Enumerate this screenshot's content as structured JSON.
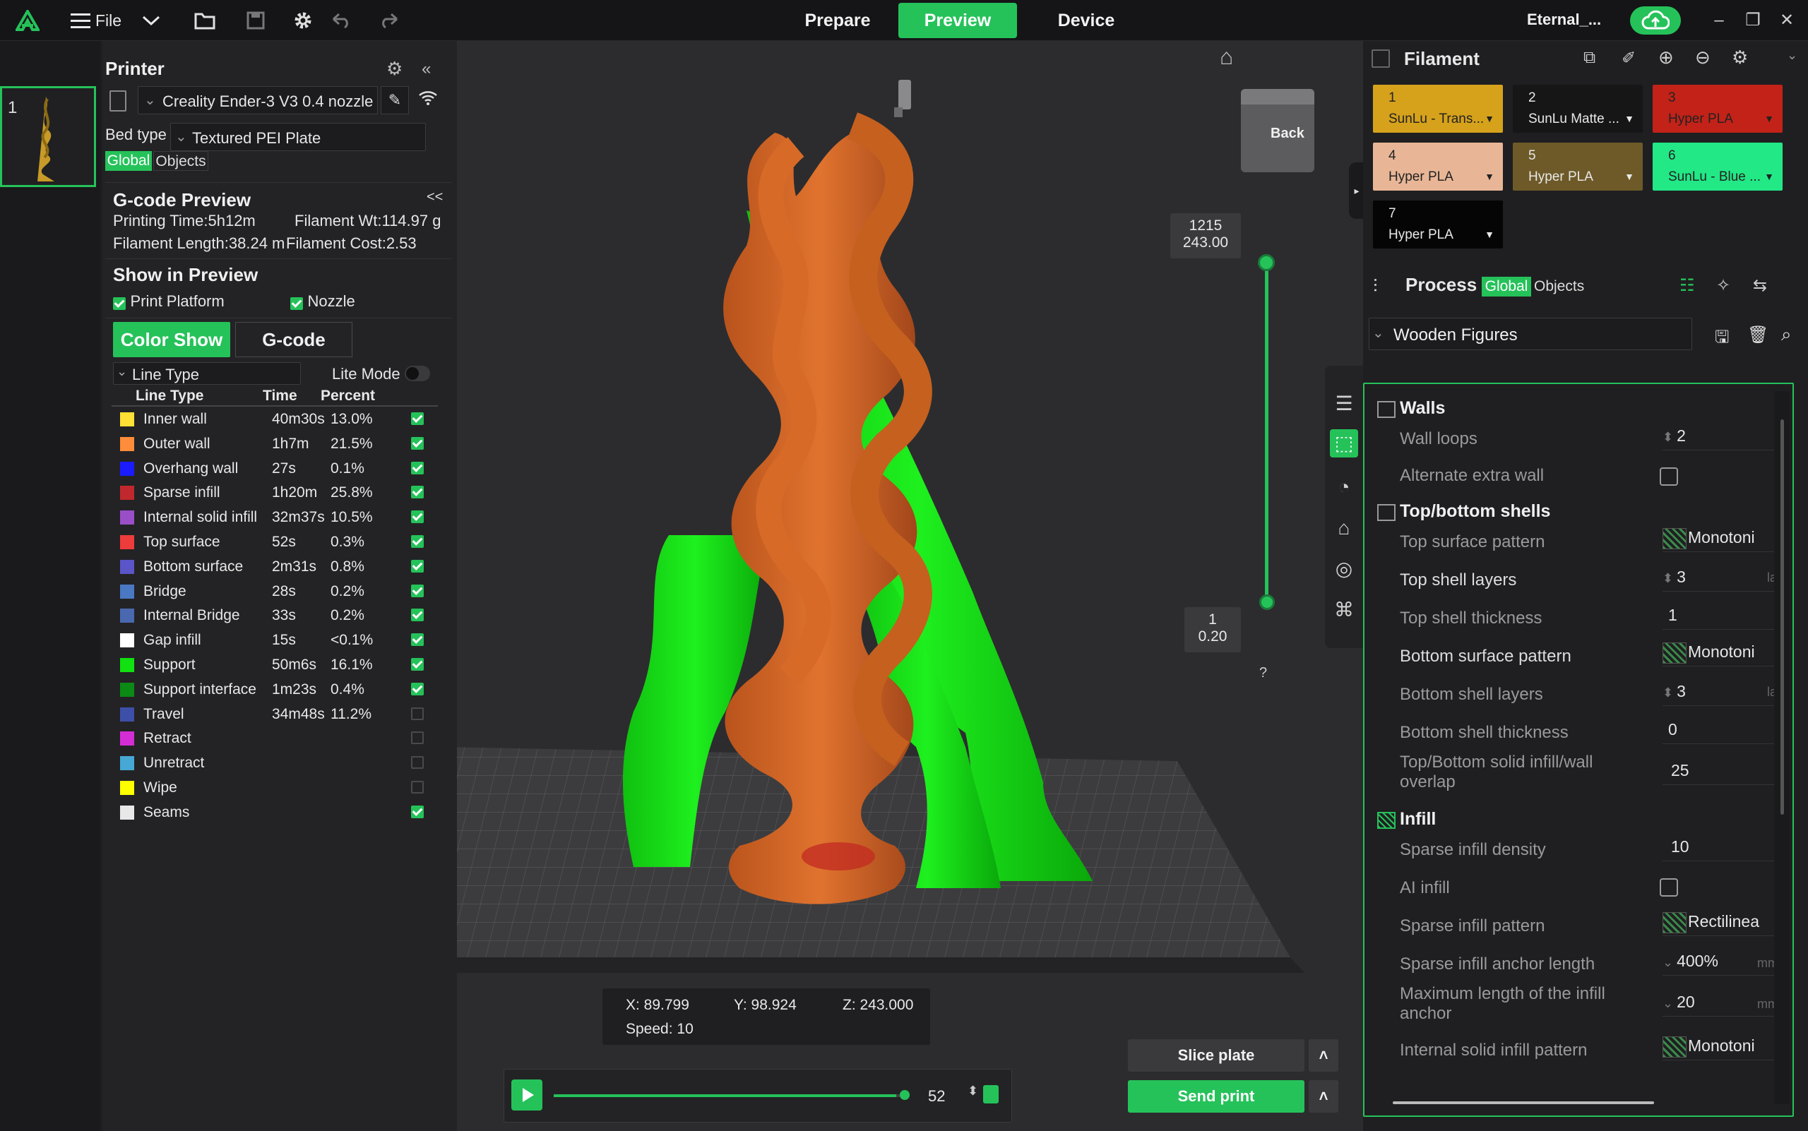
{
  "topbar": {
    "file_label": "File",
    "tabs": [
      "Prepare",
      "Preview",
      "Device"
    ],
    "user": "Eternal_..."
  },
  "thumb": {
    "number": "1"
  },
  "printer": {
    "title": "Printer",
    "name": "Creality Ender-3 V3 0.4 nozzle",
    "bed_type_label": "Bed type",
    "bed_type": "Textured PEI Plate",
    "scope_global": "Global",
    "scope_objects": "Objects"
  },
  "gcode_preview": {
    "title": "G-code Preview",
    "collapse": "<<",
    "printing_time": "Printing Time:5h12m",
    "filament_wt": "Filament Wt:114.97 g",
    "filament_length": "Filament Length:38.24 m",
    "filament_cost": "Filament Cost:2.53"
  },
  "show_in_preview": {
    "title": "Show in Preview",
    "print_platform": "Print Platform",
    "nozzle": "Nozzle"
  },
  "view_mode": {
    "color_show": "Color Show",
    "gcode": "G-code"
  },
  "line_type_selector": {
    "value": "Line Type",
    "lite_mode": "Lite Mode"
  },
  "line_table": {
    "headers": [
      "Line Type",
      "Time",
      "Percent"
    ],
    "rows": [
      {
        "name": "Inner wall",
        "time": "40m30s",
        "percent": "13.0%",
        "color": "#ffe135",
        "checked": true
      },
      {
        "name": "Outer wall",
        "time": "1h7m",
        "percent": "21.5%",
        "color": "#ff8c3a",
        "checked": true
      },
      {
        "name": "Overhang wall",
        "time": "27s",
        "percent": "0.1%",
        "color": "#1b1bff",
        "checked": true
      },
      {
        "name": "Sparse infill",
        "time": "1h20m",
        "percent": "25.8%",
        "color": "#c0282d",
        "checked": true
      },
      {
        "name": "Internal solid infill",
        "time": "32m37s",
        "percent": "10.5%",
        "color": "#9a4fc8",
        "checked": true
      },
      {
        "name": "Top surface",
        "time": "52s",
        "percent": "0.3%",
        "color": "#ee3b3b",
        "checked": true
      },
      {
        "name": "Bottom surface",
        "time": "2m31s",
        "percent": "0.8%",
        "color": "#5a55c8",
        "checked": true
      },
      {
        "name": "Bridge",
        "time": "28s",
        "percent": "0.2%",
        "color": "#4a78c2",
        "checked": true
      },
      {
        "name": "Internal Bridge",
        "time": "33s",
        "percent": "0.2%",
        "color": "#4a68b0",
        "checked": true
      },
      {
        "name": "Gap infill",
        "time": "15s",
        "percent": "<0.1%",
        "color": "#ffffff",
        "checked": true
      },
      {
        "name": "Support",
        "time": "50m6s",
        "percent": "16.1%",
        "color": "#11e011",
        "checked": true
      },
      {
        "name": "Support interface",
        "time": "1m23s",
        "percent": "0.4%",
        "color": "#0b8a16",
        "checked": true
      },
      {
        "name": "Travel",
        "time": "34m48s",
        "percent": "11.2%",
        "color": "#3d4fa8",
        "checked": false
      },
      {
        "name": "Retract",
        "time": "",
        "percent": "",
        "color": "#d52dd5",
        "checked": false
      },
      {
        "name": "Unretract",
        "time": "",
        "percent": "",
        "color": "#46a8d4",
        "checked": false
      },
      {
        "name": "Wipe",
        "time": "",
        "percent": "",
        "color": "#ffff00",
        "checked": false
      },
      {
        "name": "Seams",
        "time": "",
        "percent": "",
        "color": "#e8e8e8",
        "checked": true
      }
    ]
  },
  "viewport": {
    "view_cube": "Back",
    "layer_top": "1215",
    "height_top": "243.00",
    "layer_bottom": "1",
    "height_bottom": "0.20",
    "help": "?",
    "coords": {
      "x": "X: 89.799",
      "y": "Y: 98.924",
      "z": "Z: 243.000",
      "speed": "Speed: 10"
    },
    "progress_value": "52",
    "progress_fraction": 0.99
  },
  "actions": {
    "slice": "Slice plate",
    "send": "Send print"
  },
  "filament": {
    "title": "Filament",
    "slots": [
      {
        "num": "1",
        "name": "SunLu - Trans...",
        "color": "#d6a21c",
        "text": "#222"
      },
      {
        "num": "2",
        "name": "SunLu Matte ...",
        "color": "#161616",
        "text": "#e8e8e8"
      },
      {
        "num": "3",
        "name": "Hyper PLA",
        "color": "#c22218",
        "text": "#222"
      },
      {
        "num": "4",
        "name": "Hyper PLA",
        "color": "#e8b696",
        "text": "#222"
      },
      {
        "num": "5",
        "name": "Hyper PLA",
        "color": "#6e5a28",
        "text": "#e8e8e8"
      },
      {
        "num": "6",
        "name": "SunLu - Blue ...",
        "color": "#22e886",
        "text": "#222"
      },
      {
        "num": "7",
        "name": "Hyper PLA",
        "color": "#050505",
        "text": "#e8e8e8"
      }
    ]
  },
  "process": {
    "title": "Process",
    "scope_global": "Global",
    "scope_objects": "Objects",
    "preset": "Wooden Figures",
    "sections": {
      "walls": "Walls",
      "top_bottom": "Top/bottom shells",
      "infill": "Infill"
    },
    "settings": {
      "wall_loops": {
        "label": "Wall loops",
        "value": "2"
      },
      "alternate_extra_wall": {
        "label": "Alternate extra wall"
      },
      "top_surface_pattern": {
        "label": "Top surface pattern",
        "value": "Monotoni"
      },
      "top_shell_layers": {
        "label": "Top shell layers",
        "value": "3",
        "unit": "la"
      },
      "top_shell_thickness": {
        "label": "Top shell thickness",
        "value": "1"
      },
      "bottom_surface_pattern": {
        "label": "Bottom surface pattern",
        "value": "Monotoni"
      },
      "bottom_shell_layers": {
        "label": "Bottom shell layers",
        "value": "3",
        "unit": "la"
      },
      "bottom_shell_thickness": {
        "label": "Bottom shell thickness",
        "value": "0"
      },
      "solid_infill_overlap": {
        "label1": "Top/Bottom solid infill/wall",
        "label2": "overlap",
        "value": "25"
      },
      "sparse_infill_density": {
        "label": "Sparse infill density",
        "value": "10"
      },
      "ai_infill": {
        "label": "AI infill"
      },
      "sparse_infill_pattern": {
        "label": "Sparse infill pattern",
        "value": "Rectilinea"
      },
      "sparse_infill_anchor": {
        "label": "Sparse infill anchor length",
        "value": "400%",
        "unit": "mm"
      },
      "max_infill_anchor": {
        "label1": "Maximum length of the infill",
        "label2": "anchor",
        "value": "20",
        "unit": "mm"
      },
      "internal_solid_pattern": {
        "label": "Internal solid infill pattern",
        "value": "Monotoni"
      }
    }
  }
}
